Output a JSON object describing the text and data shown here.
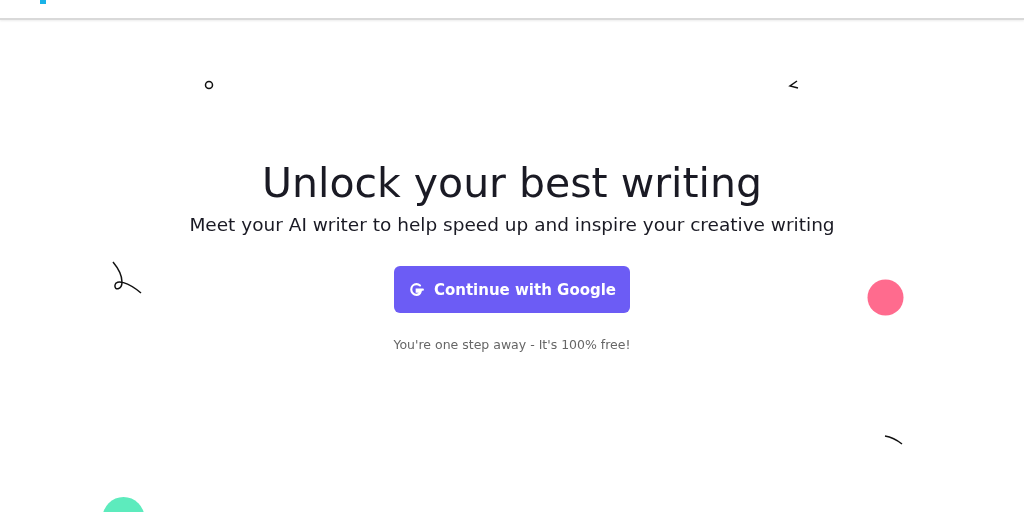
{
  "hero": {
    "title": "Unlock your best writing",
    "subtitle": "Meet your AI writer to help speed up and inspire your creative writing"
  },
  "signin_button": {
    "label": "Continue with Google"
  },
  "note": "You're one step away - It's 100% free!"
}
